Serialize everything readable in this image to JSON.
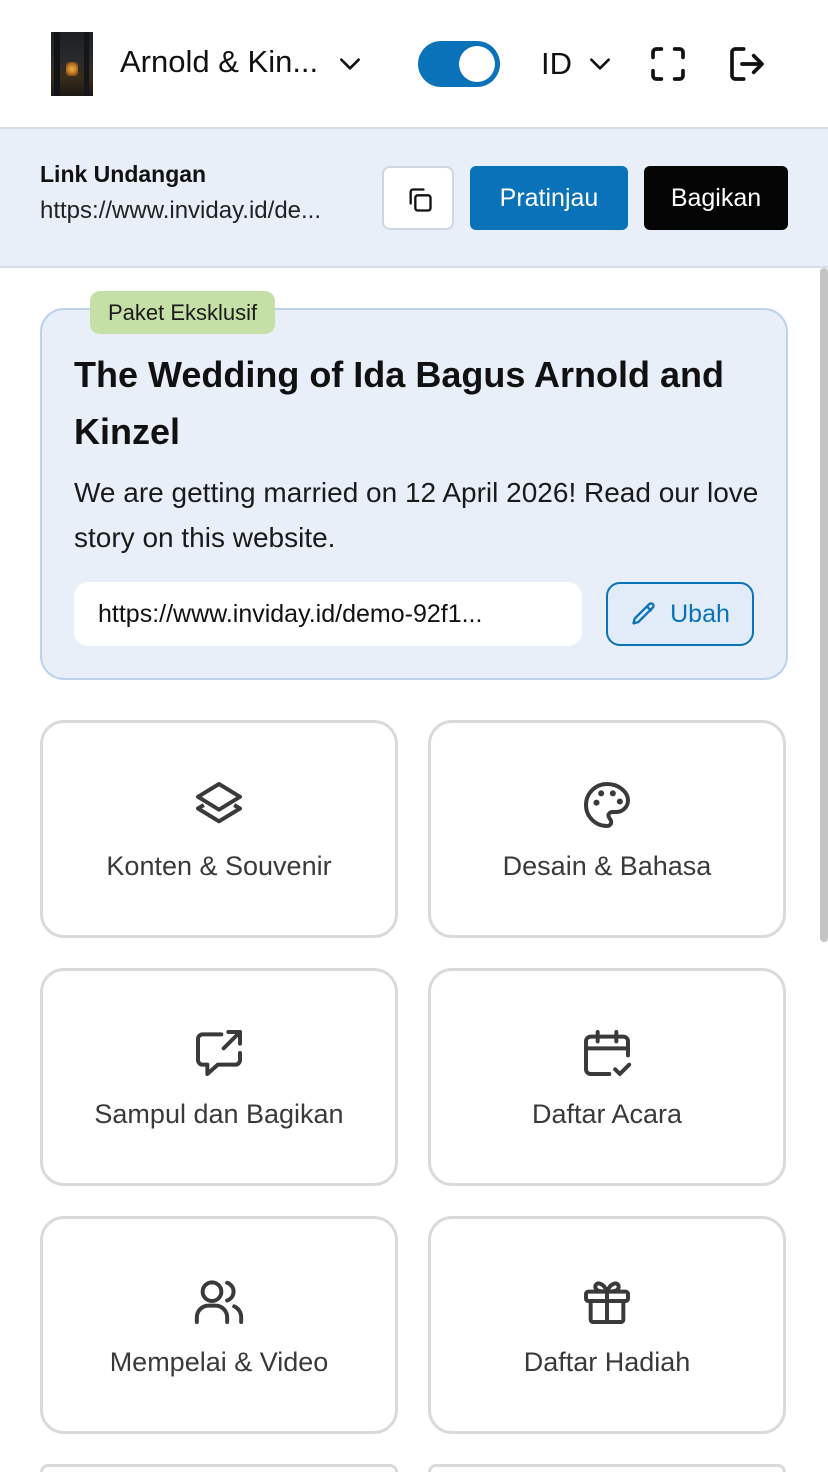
{
  "header": {
    "event_name": "Arnold & Kin...",
    "toggle_on": true,
    "language": "ID",
    "icons": [
      "chevron-down-icon",
      "fullscreen-icon",
      "logout-icon"
    ]
  },
  "link_bar": {
    "title": "Link Undangan",
    "url": "https://www.inviday.id/de...",
    "preview_label": "Pratinjau",
    "share_label": "Bagikan"
  },
  "package": {
    "badge": "Paket Eksklusif",
    "title": "The Wedding of Ida Bagus Arnold and Kinzel",
    "description": "We are getting married on 12 April 2026! Read our love story on this website.",
    "url": "https://www.inviday.id/demo-92f1...",
    "edit_label": "Ubah"
  },
  "menu": {
    "items": [
      {
        "label": "Konten & Souvenir",
        "icon": "layers-icon"
      },
      {
        "label": "Desain & Bahasa",
        "icon": "palette-icon"
      },
      {
        "label": "Sampul dan Bagikan",
        "icon": "share-message-icon"
      },
      {
        "label": "Daftar Acara",
        "icon": "calendar-check-icon"
      },
      {
        "label": "Mempelai & Video",
        "icon": "users-icon"
      },
      {
        "label": "Daftar Hadiah",
        "icon": "gift-icon"
      }
    ]
  },
  "colors": {
    "primary": "#0a72b8",
    "link_bar_bg": "#e8eff9",
    "badge_bg": "#c5e0a6",
    "dark_button": "#050505"
  }
}
